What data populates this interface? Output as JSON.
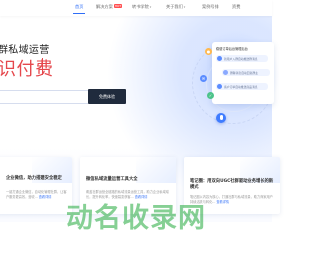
{
  "nav": {
    "items": [
      {
        "label": "首页",
        "active": true
      },
      {
        "label": "解决方案",
        "badge": "HOT"
      },
      {
        "label": "转书学院"
      },
      {
        "label": "关于我们"
      },
      {
        "label": "案例号排"
      },
      {
        "label": "资费"
      }
    ]
  },
  "hero": {
    "line1": "群私域运营",
    "line2": "识付费",
    "input_placeholder": "",
    "button_label": "免费体验"
  },
  "illustration": {
    "card_title": "稳健订单后台管理后台",
    "rows": [
      "新用户入群自动推送群消息",
      "群聊消息自动回复群主",
      "客户订单自动推送商品消息"
    ]
  },
  "cards": [
    {
      "title": "企业微信，助力搭建安全稳定",
      "desc": "一键打通企业微信，自动化管理社群，让客户服务更高效，营收...",
      "more": "查看详情"
    },
    {
      "title": "微信私域流量运营工具大全",
      "desc": "覆盖社群运营全链路的私域流量运营工具，助力企业私域增长，提升转化率，快速裂变获客...",
      "more": "查看详情"
    },
    {
      "title": "笔记圈：用双向UGC社群驱动业务增长的新模式",
      "desc": "笔记圈以内容为核心，打通社群与私域流量，助力商家用户持续活跃与转化...",
      "more": "查看详情"
    }
  ],
  "watermark": "动名收录网",
  "colors": {
    "accent": "#2f6ef7",
    "hero_highlight": "#e5484d",
    "button_dark": "#202b3d",
    "watermark": "#22aa3c"
  }
}
